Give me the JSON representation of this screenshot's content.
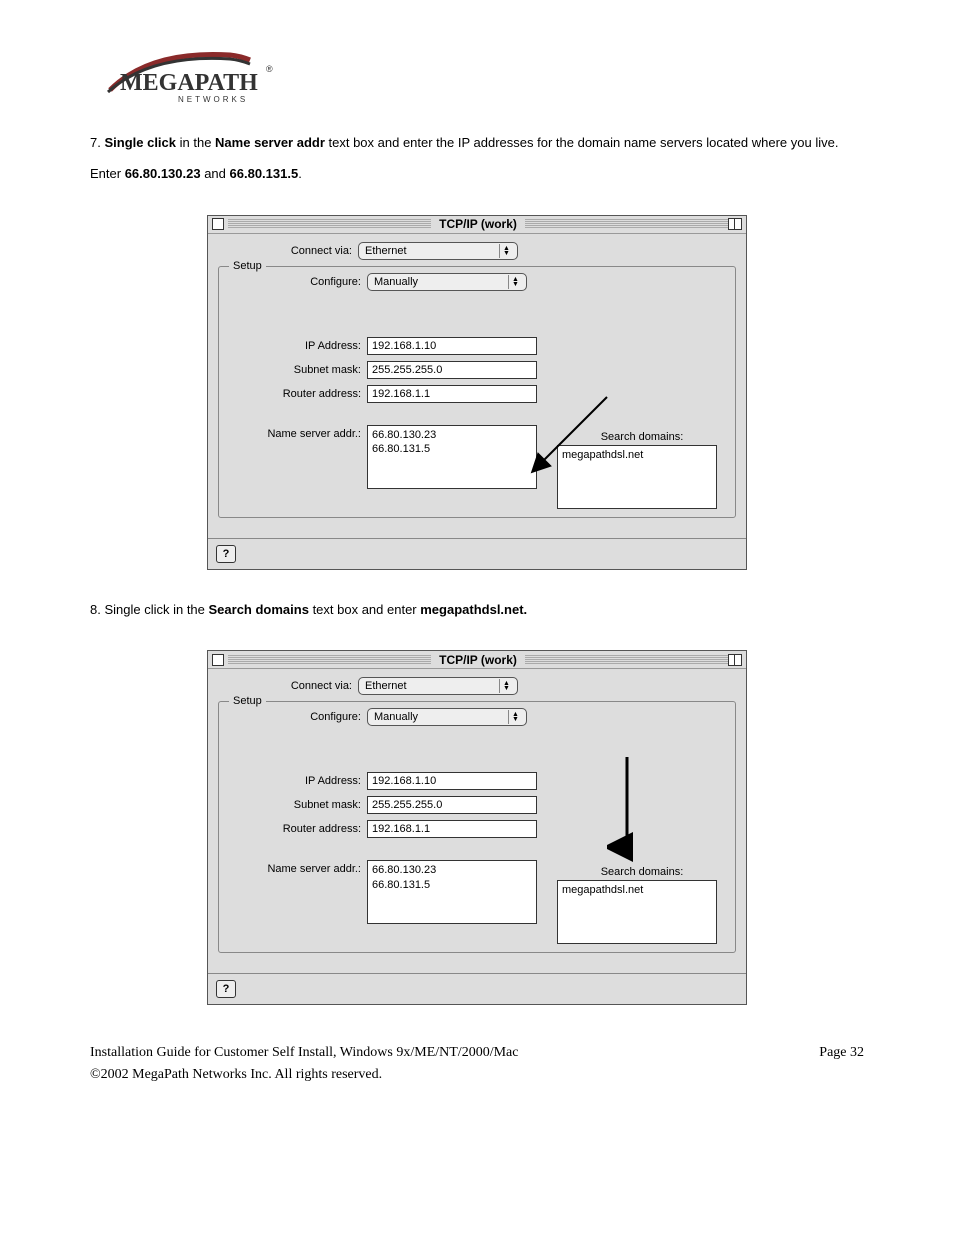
{
  "logo": {
    "brand_main": "MEGAPATH",
    "brand_sub": "N E T W O R K S"
  },
  "step7": {
    "num": "7. ",
    "bold1": "Single click",
    "mid1": " in the ",
    "bold2": "Name server addr",
    "tail": " text box and enter the IP addresses for the domain name servers located where you live.",
    "line2a": "Enter ",
    "ip1": "66.80.130.23",
    "line2b": " and ",
    "ip2": "66.80.131.5",
    "line2c": "."
  },
  "step8": {
    "num": "8. Single click in the ",
    "bold1": "Search domains",
    "mid": " text box and enter ",
    "bold2": "megapathdsl.net."
  },
  "dialog": {
    "title": "TCP/IP (work)",
    "connect_via_label": "Connect via:",
    "connect_via_value": "Ethernet",
    "setup_legend": "Setup",
    "configure_label": "Configure:",
    "configure_value": "Manually",
    "ip_label": "IP Address:",
    "ip_value": "192.168.1.10",
    "subnet_label": "Subnet mask:",
    "subnet_value": "255.255.255.0",
    "router_label": "Router address:",
    "router_value": "192.168.1.1",
    "ns_label": "Name server addr.:",
    "ns_value": "66.80.130.23\n66.80.131.5",
    "search_label": "Search domains:",
    "search_value": "megapathdsl.net",
    "help": "?"
  },
  "footer": {
    "left": "Installation Guide for Customer Self Install, Windows 9x/ME/NT/2000/Mac",
    "right": "Page 32",
    "copy": "2002 MegaPath Networks Inc. All rights reserved."
  }
}
